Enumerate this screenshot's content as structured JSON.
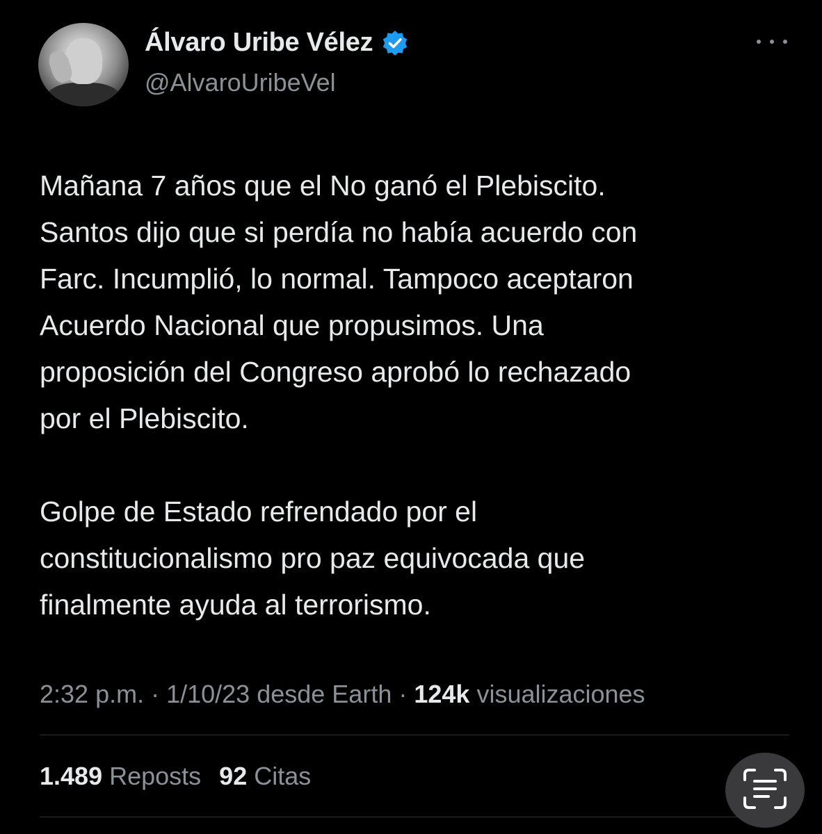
{
  "author": {
    "display_name": "Álvaro Uribe Vélez",
    "handle": "@AlvaroUribeVel"
  },
  "tweet": {
    "text": "Mañana 7 años que el No ganó el Plebiscito.\nSantos dijo que si perdía no había acuerdo con\nFarc. Incumplió, lo normal. Tampoco aceptaron\nAcuerdo Nacional que propusimos. Una\nproposición del Congreso aprobó lo rechazado\npor el Plebiscito.\n\nGolpe de Estado refrendado por el\nconstitucionalismo pro paz equivocada que\nfinalmente ayuda al terrorismo."
  },
  "meta": {
    "time": "2:32 p.m.",
    "separator": " · ",
    "date": "1/10/23 desde Earth",
    "views_count": "124k",
    "views_label": " visualizaciones"
  },
  "stats": {
    "reposts_count": "1.489",
    "reposts_label": " Reposts",
    "quotes_count": "92",
    "quotes_label": " Citas"
  },
  "icons": {
    "verified": "verified-badge-icon",
    "more": "more-options-icon",
    "scan": "text-scan-icon"
  },
  "colors": {
    "background": "#000000",
    "primary_text": "#e7e9ea",
    "secondary_text": "#8b9196",
    "verified_blue": "#1d9bf0"
  }
}
